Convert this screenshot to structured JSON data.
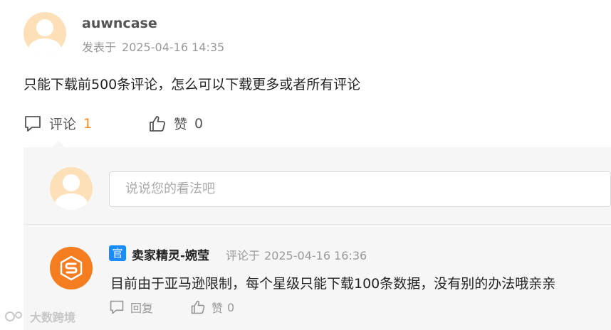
{
  "post": {
    "username": "auwncase",
    "posted_prefix": "发表于",
    "posted_time": "2025-04-16 14:35",
    "content": "只能下载前500条评论，怎么可以下载更多或者所有评论"
  },
  "actions": {
    "comment_label": "评论",
    "comment_count": "1",
    "like_label": "赞",
    "like_count": "0"
  },
  "comment_box": {
    "placeholder": "说说您的看法吧"
  },
  "reply": {
    "badge": "官",
    "username": "卖家精灵-婉莹",
    "time_prefix": "评论于",
    "time": "2025-04-16 16:36",
    "content": "目前由于亚马逊限制，每个星级只能下载100条数据，没有别的办法哦亲亲",
    "reply_label": "回复",
    "like_label": "赞",
    "like_count": "0"
  },
  "watermark": {
    "text": "大数跨境"
  },
  "colors": {
    "accent_orange": "#f08c1e",
    "avatar_peach": "#fde0b8",
    "brand_orange": "#f57c1f",
    "official_blue": "#1a8cff",
    "panel_bg": "#f6f6f6"
  },
  "icons": {
    "comment": "speech-bubble-icon",
    "like": "thumbs-up-icon",
    "reply_logo": "s-logo-icon",
    "watermark": "watermark-logo-icon"
  }
}
